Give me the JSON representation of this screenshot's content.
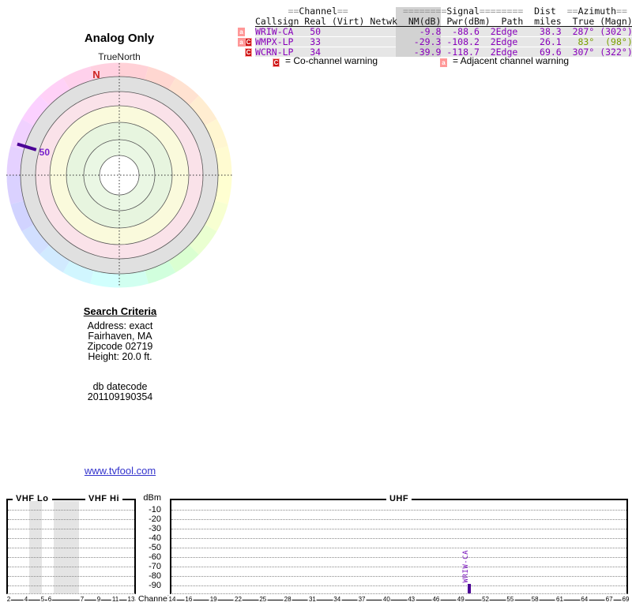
{
  "polar": {
    "title": "Analog Only",
    "north_label": "TrueNorth",
    "compass_n": "N",
    "marker_label": "50"
  },
  "table": {
    "groups": {
      "channel_pre": "==",
      "channel": "Channel",
      "channel_post": "==",
      "signal_pre": "========",
      "signal": "Signal",
      "signal_post": "========",
      "dist": "Dist",
      "azimuth_pre": "==",
      "azimuth": "Azimuth",
      "azimuth_post": "=="
    },
    "columns": {
      "callsign": "Callsign",
      "real": "Real",
      "virt": "(Virt)",
      "netwk": "Netwk",
      "nm": "NM(dB)",
      "pwr": "Pwr(dBm)",
      "path": "Path",
      "miles": "miles",
      "true": "True",
      "magn": "(Magn)"
    },
    "rows": [
      {
        "badge_a": "a",
        "badge_c": "",
        "callsign": "WRIW-CA",
        "real": "50",
        "virt": "",
        "netwk": "",
        "nm": "-9.8",
        "pwr": "-88.6",
        "path": "2Edge",
        "miles": "38.3",
        "true": "287°",
        "magn": "(302°)",
        "az_color": "#8800bb"
      },
      {
        "badge_a": "a",
        "badge_c": "C",
        "callsign": "WMPX-LP",
        "real": "33",
        "virt": "",
        "netwk": "",
        "nm": "-29.3",
        "pwr": "-108.2",
        "path": "2Edge",
        "miles": "26.1",
        "true": "83°",
        "magn": "(98°)",
        "az_color": "#7aa000"
      },
      {
        "badge_a": "",
        "badge_c": "C",
        "callsign": "WCRN-LP",
        "real": "34",
        "virt": "",
        "netwk": "",
        "nm": "-39.9",
        "pwr": "-118.7",
        "path": "2Edge",
        "miles": "69.6",
        "true": "307°",
        "magn": "(322°)",
        "az_color": "#8800bb"
      }
    ],
    "legend": [
      {
        "badge": "C",
        "text": "= Co-channel warning"
      },
      {
        "badge": "a",
        "text": "= Adjacent channel warning"
      }
    ]
  },
  "search_criteria": {
    "title": "Search Criteria",
    "lines": [
      "Address: exact",
      "Fairhaven, MA",
      "Zipcode 02719",
      "Height: 20.0 ft."
    ],
    "db_label": "db datecode",
    "db_code": "201109190354"
  },
  "link": {
    "text": "www.tvfool.com"
  },
  "spectrum": {
    "dbm_label": "dBm",
    "channel_label": "Channel",
    "band_labels": {
      "vhf_lo": "VHF Lo",
      "vhf_hi": "VHF Hi",
      "uhf": "UHF"
    },
    "dbm_ticks": [
      "-10",
      "-20",
      "-30",
      "-40",
      "-50",
      "-60",
      "-70",
      "-80",
      "-90"
    ],
    "vhf_channels": [
      "2",
      "4",
      "5",
      "6",
      "7",
      "9",
      "11",
      "13"
    ],
    "uhf_channels": [
      "14",
      "16",
      "19",
      "22",
      "25",
      "28",
      "31",
      "34",
      "37",
      "40",
      "43",
      "46",
      "49",
      "52",
      "55",
      "58",
      "61",
      "64",
      "67",
      "69"
    ]
  },
  "colors": {
    "station_text": "#8800bb",
    "azimuth_alt": "#7aa000",
    "co_channel_badge": "#cc1111",
    "adjacent_badge": "#ff9898",
    "link": "#3333cc",
    "marker": "#4b0096",
    "compass_n": "#cc2222"
  },
  "chart_data": [
    {
      "type": "radar",
      "title": "Analog Only",
      "orientation_label": "TrueNorth",
      "stations": [
        {
          "callsign": "WRIW-CA",
          "channel": 50,
          "azimuth_true_deg": 287,
          "azimuth_magnetic_deg": 302,
          "marker_label": "50"
        }
      ]
    },
    {
      "type": "bar",
      "xlabel": "Channel",
      "ylabel": "dBm",
      "ylim": [
        -100,
        0
      ],
      "yticks": [
        -10,
        -20,
        -30,
        -40,
        -50,
        -60,
        -70,
        -80,
        -90
      ],
      "bands": [
        "VHF Lo",
        "VHF Hi",
        "UHF"
      ],
      "x_channels_vhf": [
        2,
        4,
        5,
        6,
        7,
        9,
        11,
        13
      ],
      "x_channels_uhf": [
        14,
        16,
        19,
        22,
        25,
        28,
        31,
        34,
        37,
        40,
        43,
        46,
        49,
        52,
        55,
        58,
        61,
        64,
        67,
        69
      ],
      "bars": [
        {
          "callsign": "WRIW-CA",
          "channel": 50,
          "pwr_dbm": -88.6
        }
      ]
    }
  ]
}
